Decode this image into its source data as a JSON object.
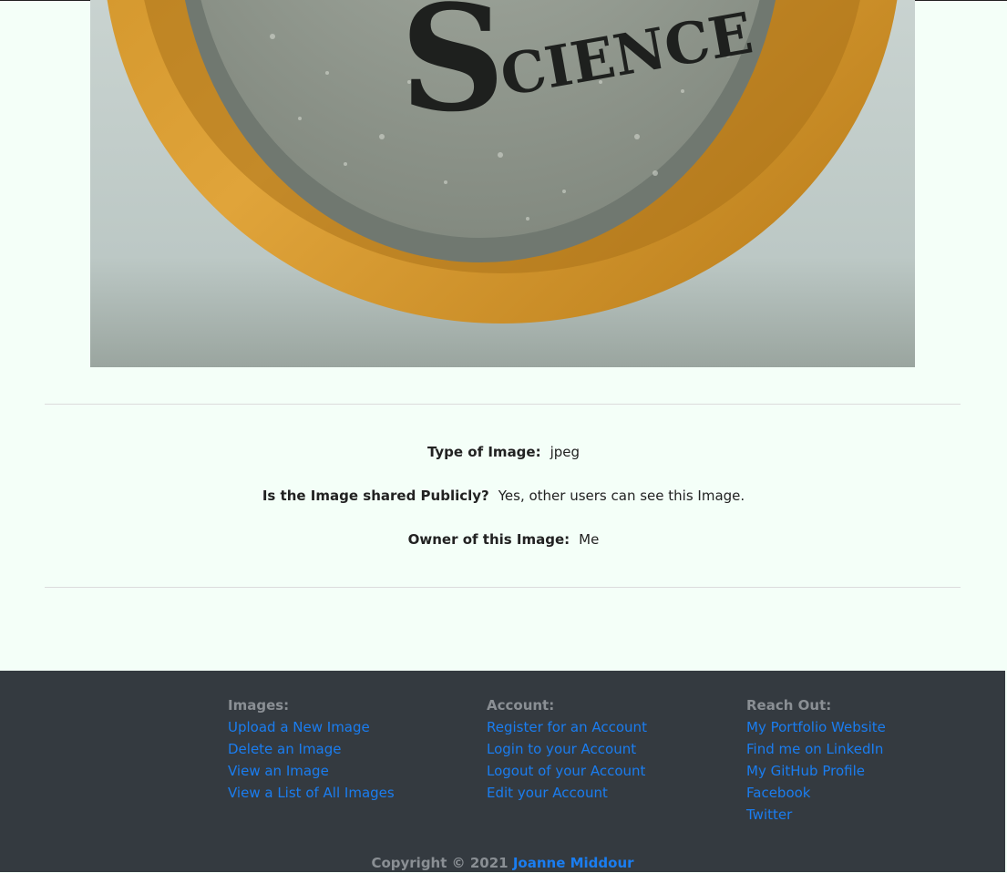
{
  "image_view": {
    "logo_text": "SCIENCE"
  },
  "details": [
    {
      "label": "Type of Image:",
      "value": "jpeg"
    },
    {
      "label": "Is the Image shared Publicly?",
      "value": "Yes, other users can see this Image."
    },
    {
      "label": "Owner of this Image:",
      "value": "Me"
    }
  ],
  "footer": {
    "images": {
      "heading": "Images:",
      "links": [
        "Upload a New Image",
        "Delete an Image",
        "View an Image",
        "View a List of All Images"
      ]
    },
    "account": {
      "heading": "Account:",
      "links": [
        "Register for an Account",
        "Login to your Account",
        "Logout of your Account",
        "Edit your Account"
      ]
    },
    "reach_out": {
      "heading": "Reach Out:",
      "links": [
        "My Portfolio Website",
        "Find me on LinkedIn",
        "My GitHub Profile",
        "Facebook",
        "Twitter"
      ]
    },
    "copyright_prefix": "Copyright © 2021",
    "author": "Joanne Middour"
  },
  "colors": {
    "page_bg": "#f4fff8",
    "footer_bg": "#343a40",
    "link": "#1a7df0",
    "muted": "#8a8f94"
  }
}
